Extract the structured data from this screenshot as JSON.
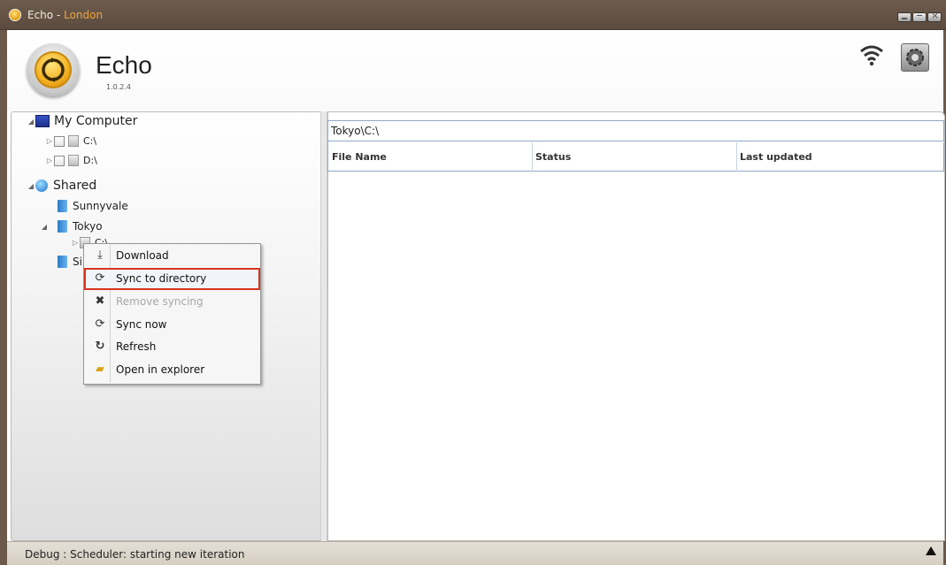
{
  "window": {
    "title_app": "Echo - ",
    "title_location": "London",
    "minimize_icon": "minimize-icon",
    "maximize_icon": "maximize-icon",
    "close_icon": "close-icon"
  },
  "header": {
    "app_name": "Echo",
    "version": "1.0.2.4",
    "logo_icon": "sync-logo-icon",
    "wifi_icon": "wifi-icon",
    "settings_icon": "settings-gear-icon"
  },
  "tree": {
    "my_computer": {
      "label": "My Computer",
      "icon": "computer-icon"
    },
    "drives": [
      {
        "label": "C:\\",
        "icon": "drive-icon"
      },
      {
        "label": "D:\\",
        "icon": "drive-icon"
      }
    ],
    "shared": {
      "label": "Shared",
      "icon": "globe-icon"
    },
    "shared_items": [
      {
        "label": "Sunnyvale",
        "icon": "folder-icon"
      },
      {
        "label": "Tokyo",
        "icon": "folder-icon"
      },
      {
        "label": "C:\\",
        "icon": "drive-icon"
      },
      {
        "label": "Si",
        "icon": "folder-icon"
      }
    ]
  },
  "file_list": {
    "path": "Tokyo\\C:\\",
    "columns": [
      "File Name",
      "Status",
      "Last updated"
    ],
    "rows": []
  },
  "context_menu": {
    "items": [
      {
        "label": "Download",
        "icon": "download-icon",
        "disabled": false
      },
      {
        "label": "Sync to directory",
        "icon": "sync-icon",
        "disabled": false,
        "highlighted": true
      },
      {
        "label": "Remove syncing",
        "icon": "remove-x-icon",
        "disabled": true
      },
      {
        "label": "Sync now",
        "icon": "sync-icon",
        "disabled": false
      },
      {
        "label": "Refresh",
        "icon": "refresh-icon",
        "disabled": false
      },
      {
        "label": "Open in explorer",
        "icon": "folder-open-icon",
        "disabled": false
      }
    ]
  },
  "status_bar": {
    "text": "Debug : Scheduler: starting new iteration",
    "toggle_icon": "expand-up-icon"
  },
  "colors": {
    "title_bar": "#5f4f42",
    "title_accent": "#f0a33a",
    "menu_highlight_border": "#d9341f",
    "header_border": "#8fa9c5"
  }
}
